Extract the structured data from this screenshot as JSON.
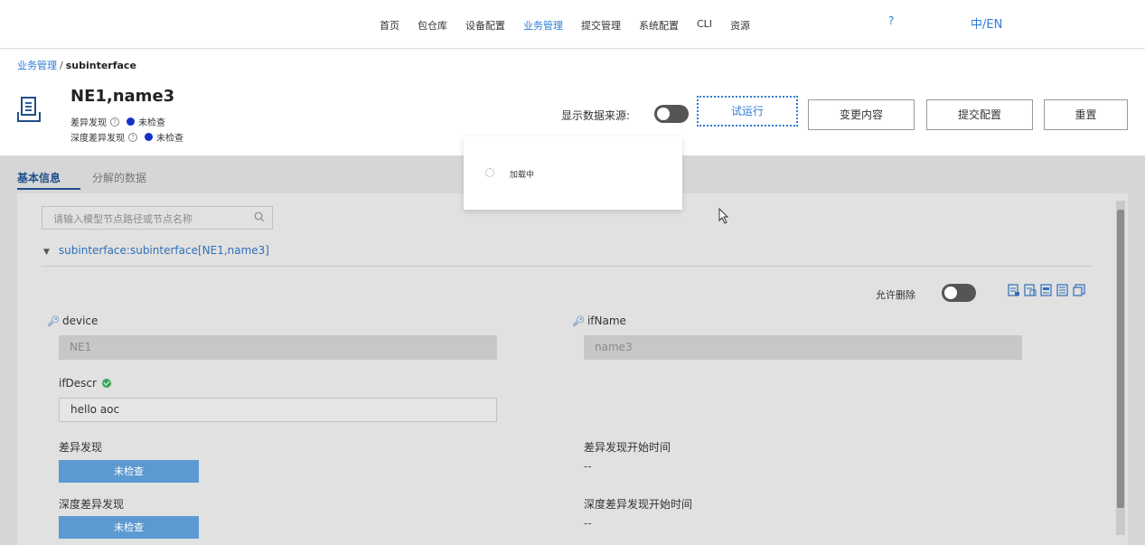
{
  "nav": {
    "items": [
      "首页",
      "包仓库",
      "设备配置",
      "业务管理",
      "提交管理",
      "系统配置",
      "CLI",
      "资源"
    ],
    "active_index": 3,
    "help": "?",
    "lang": "中/EN"
  },
  "breadcrumb": {
    "parent": "业务管理",
    "separator": "/",
    "current": "subinterface"
  },
  "header": {
    "title": "NE1,name3",
    "diff_label": "差异发现",
    "diff_status": "未检查",
    "deep_diff_label": "深度差异发现",
    "deep_diff_status": "未检查",
    "source_label": "显示数据来源:"
  },
  "toolbar": {
    "trial_run": "试运行",
    "change_content": "变更内容",
    "submit_config": "提交配置",
    "reset": "重置"
  },
  "loading": {
    "text": "加载中"
  },
  "tabs": {
    "basic": "基本信息",
    "decomposed": "分解的数据"
  },
  "panel": {
    "search_placeholder": "请输入模型节点路径或节点名称",
    "tree_node": "subinterface:subinterface[NE1,name3]",
    "allow_delete": "允许删除",
    "fields": {
      "device_label": "device",
      "device_value": "NE1",
      "ifname_label": "ifName",
      "ifname_value": "name3",
      "ifdescr_label": "ifDescr",
      "ifdescr_value": "hello aoc",
      "diff_label": "差异发现",
      "diff_button": "未检查",
      "diff_start_label": "差异发现开始时间",
      "diff_start_value": "--",
      "deep_label": "深度差异发现",
      "deep_button": "未检查",
      "deep_start_label": "深度差异发现开始时间",
      "deep_start_value": "--"
    }
  },
  "colors": {
    "accent": "#2f7cd6",
    "status_dot": "#1330c9",
    "status_button": "#5b9ad1",
    "success": "#3aa65c"
  }
}
